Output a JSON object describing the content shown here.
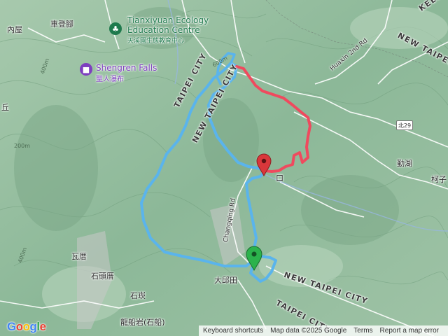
{
  "colors": {
    "route_blue": "#5ab4ec",
    "route_red": "#ef4a5e",
    "start_marker": "#2bb24c",
    "end_marker": "#d9373b",
    "poi_green": "#1f7a4d",
    "poi_purple": "#7e3fbf"
  },
  "places": {
    "neiwu": "內屋",
    "chedengjiao": "車登腳",
    "tianxiyuan_en_1": "Tianxiyuan Ecology",
    "tianxiyuan_en_2": "Education Centre",
    "tianxiyuan_zh": "天溪園生態教育中心",
    "shengren_en": "Shengren Falls",
    "shengren_zh": "聖人瀑布",
    "keelung": "KEELUN",
    "new_taipei_ne": "NEW TAIPEI",
    "huaxin": "Huaxin 2nd Rd",
    "taipei_city_n": "TAIPEI CITY",
    "new_taipei_city_n": "NEW TAIPEI CITY",
    "route_shield": "北29",
    "qinhu": "勤湖",
    "kezi": "柯子",
    "qiu": "丘",
    "kou": "口",
    "changqing": "Changqing Rd",
    "waci": "瓦厝",
    "shitoucuo": "石頭厝",
    "shikan": "石崁",
    "daqiutian": "大邱田",
    "new_taipei_city_s": "NEW TAIPEI CITY",
    "taipei_city_s": "TAIPEI CITY",
    "longchuanyan": "龍船岩(石船)",
    "contour_400_a": "400m",
    "contour_400_b": "400m",
    "contour_200_a": "200m",
    "contour_600": "600m"
  },
  "icons": {
    "tianxiyuan": "tree-icon",
    "shengren": "camera-icon",
    "start": "start-pin-icon",
    "end": "end-pin-icon"
  },
  "attribution": {
    "logo": "Google",
    "shortcuts": "Keyboard shortcuts",
    "data": "Map data ©2025 Google",
    "terms": "Terms",
    "report": "Report a map error"
  }
}
